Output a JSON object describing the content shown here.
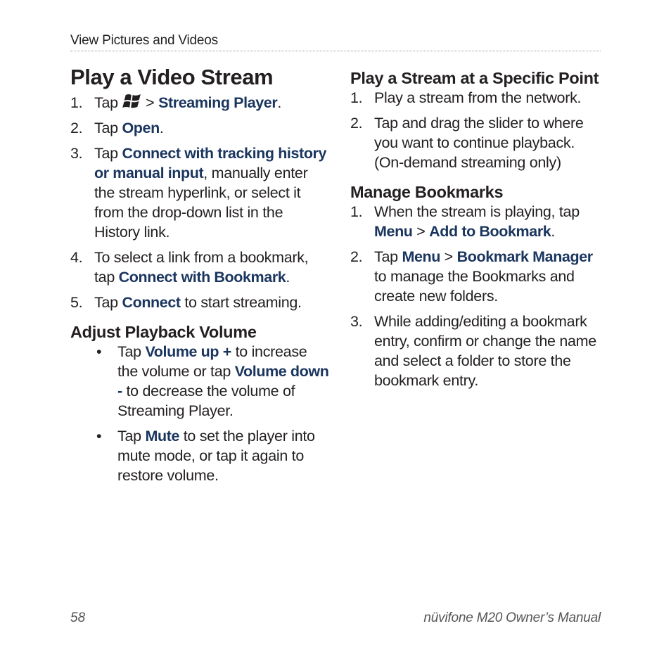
{
  "header": {
    "section": "View Pictures and Videos"
  },
  "left": {
    "title": "Play a Video Stream",
    "steps": [
      {
        "num": "1.",
        "pre": "Tap ",
        "icon": "windows-start-icon",
        "sep": " > ",
        "ui1": "Streaming Player",
        "post": "."
      },
      {
        "num": "2.",
        "pre": "Tap ",
        "ui1": "Open",
        "post": "."
      },
      {
        "num": "3.",
        "pre": "Tap ",
        "ui1": "Connect with tracking history or manual input",
        "post": ", manually enter the stream hyperlink, or select it from the drop-down list in the History link."
      },
      {
        "num": "4.",
        "pre": "To select a link from a bookmark, tap ",
        "ui1": "Connect with Bookmark",
        "post": "."
      },
      {
        "num": "5.",
        "pre": "Tap ",
        "ui1": "Connect",
        "post": " to start streaming."
      }
    ],
    "volume_heading": "Adjust Playback Volume",
    "bullets": [
      {
        "mark": "•",
        "pre": "Tap ",
        "ui1": "Volume up +",
        "mid": " to increase the volume or tap ",
        "ui2": "Volume down -",
        "post": " to decrease the volume of Streaming Player."
      },
      {
        "mark": "•",
        "pre": "Tap ",
        "ui1": "Mute",
        "post": " to set the player into mute mode, or tap it again to restore volume."
      }
    ]
  },
  "right": {
    "specific_heading": "Play a Stream at a Specific Point",
    "specific_steps": [
      {
        "num": "1.",
        "text": "Play a stream from the network."
      },
      {
        "num": "2.",
        "text": "Tap and drag the slider to where you want to continue playback. (On-demand streaming only)"
      }
    ],
    "bookmarks_heading": "Manage Bookmarks",
    "bookmark_steps": [
      {
        "num": "1.",
        "pre": "When the stream is playing, tap ",
        "ui1": "Menu",
        "sep": " > ",
        "ui2": "Add to Bookmark",
        "post": "."
      },
      {
        "num": "2.",
        "pre": "Tap ",
        "ui1": "Menu",
        "sep": " > ",
        "ui2": "Bookmark Manager",
        "post": " to manage the Bookmarks and create new folders."
      },
      {
        "num": "3.",
        "text": "While adding/editing a bookmark entry, confirm or change the name and select a folder to store the bookmark entry."
      }
    ]
  },
  "footer": {
    "page_number": "58",
    "manual_title": "nüvifone M20 Owner’s Manual"
  },
  "colors": {
    "ui_term": "#1a355e",
    "body_text": "#231f20",
    "footer_text": "#555555"
  }
}
